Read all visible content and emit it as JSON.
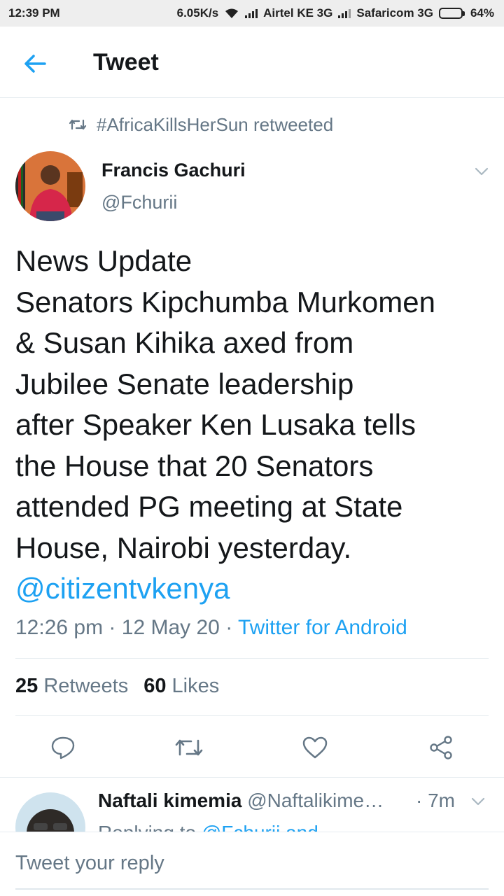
{
  "status_bar": {
    "time": "12:39 PM",
    "speed": "6.05K/s",
    "carrier1": "Airtel KE 3G",
    "carrier2": "Safaricom 3G",
    "battery": "64%",
    "battery_level": 0.64
  },
  "app_bar": {
    "title": "Tweet",
    "back_icon": "arrow-left-icon",
    "accent_color": "#1da1f2"
  },
  "retweet_banner": {
    "icon": "retweet-icon",
    "text": "#AfricaKillsHerSun retweeted"
  },
  "tweet": {
    "author_name": "Francis Gachuri",
    "author_handle": "@Fchurii",
    "lines": [
      "News Update",
      "Senators Kipchumba Murkomen",
      "& Susan Kihika axed from",
      "Jubilee Senate leadership",
      "after Speaker Ken Lusaka tells",
      "the House that 20 Senators",
      "attended PG meeting at State",
      "House, Nairobi yesterday."
    ],
    "mention": "@citizentvkenya",
    "time": "12:26 pm",
    "separator": " · ",
    "date": "12 May 20",
    "source": "Twitter for Android",
    "retweets_count": "25",
    "retweets_label": "Retweets",
    "likes_count": "60",
    "likes_label": "Likes"
  },
  "actions": {
    "reply_icon": "reply-icon",
    "retweet_icon": "retweet-icon",
    "like_icon": "heart-icon",
    "share_icon": "share-icon"
  },
  "reply": {
    "name": "Naftali kimemia",
    "handle": "@Naftalikime…",
    "time": "· 7m",
    "replying_prefix": "Replying to",
    "replying_to": "@Fchurii and"
  },
  "compose": {
    "placeholder": "Tweet your reply"
  }
}
